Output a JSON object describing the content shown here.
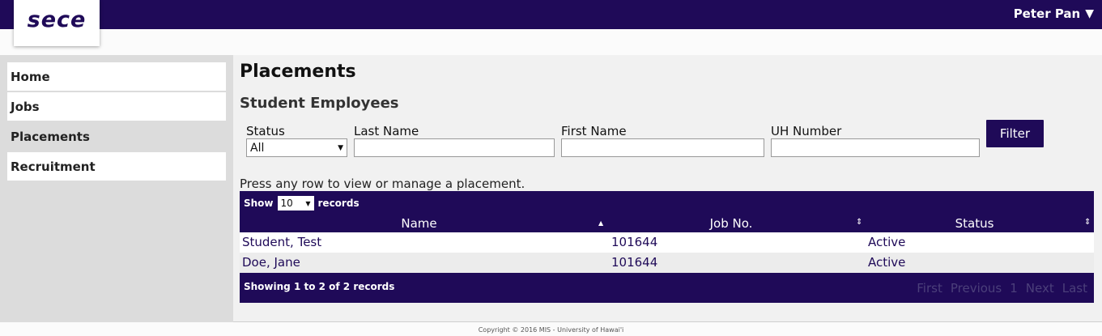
{
  "header": {
    "logo": "sece",
    "user_name": "Peter Pan",
    "user_caret": "▼"
  },
  "sidebar": {
    "items": [
      {
        "label": "Home"
      },
      {
        "label": "Jobs"
      },
      {
        "label": "Placements"
      },
      {
        "label": "Recruitment"
      }
    ]
  },
  "main": {
    "title": "Placements",
    "subtitle": "Student Employees",
    "filters": {
      "status_label": "Status",
      "status_value": "All",
      "last_name_label": "Last Name",
      "last_name_value": "",
      "first_name_label": "First Name",
      "first_name_value": "",
      "uh_number_label": "UH Number",
      "uh_number_value": "",
      "filter_button": "Filter"
    },
    "hint": "Press any row to view or manage a placement.",
    "table": {
      "show_label": "Show",
      "page_length": "10",
      "records_label": "records",
      "columns": [
        "Name",
        "Job No.",
        "Status"
      ],
      "rows": [
        {
          "name": "Student, Test",
          "job_no": "101644",
          "status": "Active"
        },
        {
          "name": "Doe, Jane",
          "job_no": "101644",
          "status": "Active"
        }
      ],
      "info": "Showing 1 to 2 of 2 records",
      "pager": {
        "first": "First",
        "previous": "Previous",
        "page": "1",
        "next": "Next",
        "last": "Last"
      }
    }
  },
  "footer": {
    "copyright": "Copyright © 2016 MIS - University of Hawai'i"
  }
}
